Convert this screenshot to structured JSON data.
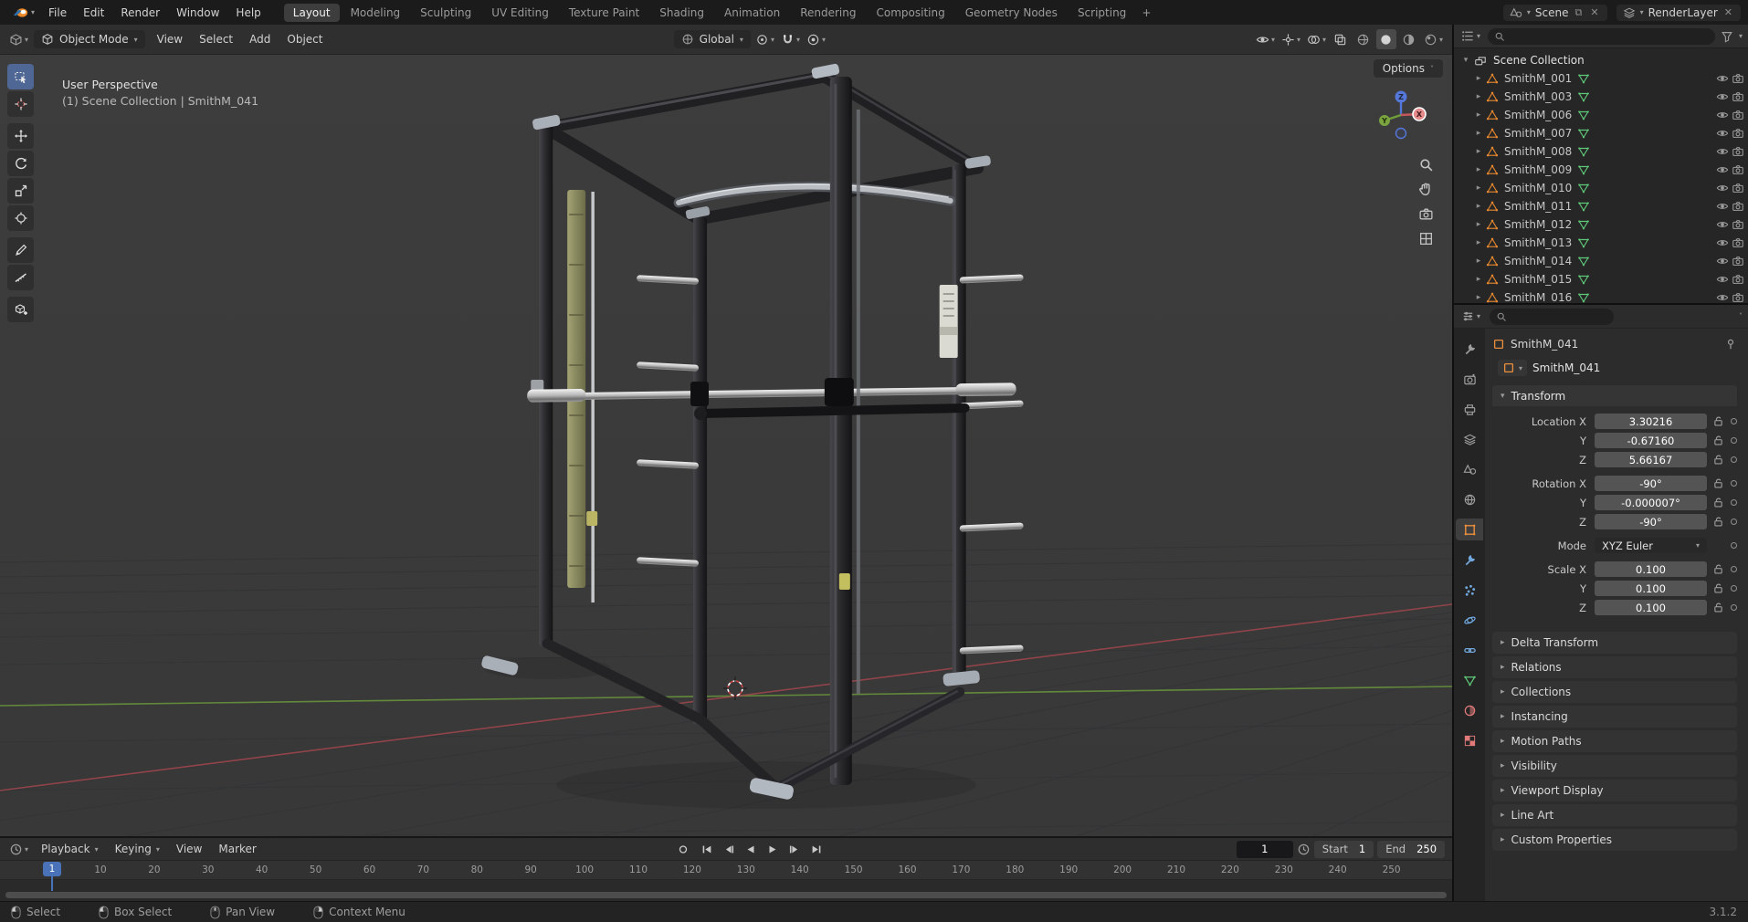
{
  "topbar": {
    "menus": [
      "File",
      "Edit",
      "Render",
      "Window",
      "Help"
    ],
    "workspaces": [
      "Layout",
      "Modeling",
      "Sculpting",
      "UV Editing",
      "Texture Paint",
      "Shading",
      "Animation",
      "Rendering",
      "Compositing",
      "Geometry Nodes",
      "Scripting"
    ],
    "active_workspace": "Layout",
    "new_workspace_label": "+",
    "scene_label": "Scene",
    "view_layer_label": "RenderLayer"
  },
  "viewport": {
    "header": {
      "mode": "Object Mode",
      "menus": [
        "View",
        "Select",
        "Add",
        "Object"
      ],
      "orientation": "Global",
      "options_label": "Options"
    },
    "overlay_line1": "User Perspective",
    "overlay_line2": "(1) Scene Collection | SmithM_041",
    "axis_x_color": "#a8484f",
    "axis_y_color": "#6d9e3c",
    "gizmo": {
      "x": "X",
      "y": "Y",
      "z": "Z"
    }
  },
  "outliner": {
    "root_label": "Scene Collection",
    "items": [
      "SmithM_001",
      "SmithM_003",
      "SmithM_006",
      "SmithM_007",
      "SmithM_008",
      "SmithM_009",
      "SmithM_010",
      "SmithM_011",
      "SmithM_012",
      "SmithM_013",
      "SmithM_014",
      "SmithM_015",
      "SmithM_016"
    ]
  },
  "properties": {
    "breadcrumb": "SmithM_041",
    "object_name": "SmithM_041",
    "transform": {
      "title": "Transform",
      "rows": [
        {
          "label": "Location X",
          "value": "3.30216",
          "kind": "number"
        },
        {
          "label": "Y",
          "value": "-0.67160",
          "kind": "number"
        },
        {
          "label": "Z",
          "value": "5.66167",
          "kind": "number",
          "gap_after": true
        },
        {
          "label": "Rotation X",
          "value": "-90°",
          "kind": "number"
        },
        {
          "label": "Y",
          "value": "-0.000007°",
          "kind": "number"
        },
        {
          "label": "Z",
          "value": "-90°",
          "kind": "number",
          "gap_after": true
        },
        {
          "label": "Mode",
          "value": "XYZ Euler",
          "kind": "dropdown",
          "gap_after": true
        },
        {
          "label": "Scale X",
          "value": "0.100",
          "kind": "number"
        },
        {
          "label": "Y",
          "value": "0.100",
          "kind": "number"
        },
        {
          "label": "Z",
          "value": "0.100",
          "kind": "number"
        }
      ]
    },
    "collapsed_sections": [
      "Delta Transform",
      "Relations",
      "Collections",
      "Instancing",
      "Motion Paths",
      "Visibility",
      "Viewport Display",
      "Line Art",
      "Custom Properties"
    ]
  },
  "timeline": {
    "menus": [
      {
        "label": "Playback",
        "caret": true
      },
      {
        "label": "Keying",
        "caret": true
      },
      {
        "label": "View",
        "caret": false
      },
      {
        "label": "Marker",
        "caret": false
      }
    ],
    "current_frame": "1",
    "playhead_frame": "1",
    "start_label": "Start",
    "start_value": "1",
    "end_label": "End",
    "end_value": "250",
    "ruler_labels": [
      "10",
      "20",
      "30",
      "40",
      "50",
      "60",
      "70",
      "80",
      "90",
      "100",
      "110",
      "120",
      "130",
      "140",
      "150",
      "160",
      "170",
      "180",
      "190",
      "200",
      "210",
      "220",
      "230",
      "240",
      "250"
    ]
  },
  "statusbar": {
    "hints": [
      {
        "label": "Select",
        "mouse": "left"
      },
      {
        "label": "Box Select",
        "mouse": "left-drag"
      },
      {
        "label": "Pan View",
        "mouse": "middle"
      },
      {
        "label": "Context Menu",
        "mouse": "right"
      }
    ],
    "version": "3.1.2"
  }
}
